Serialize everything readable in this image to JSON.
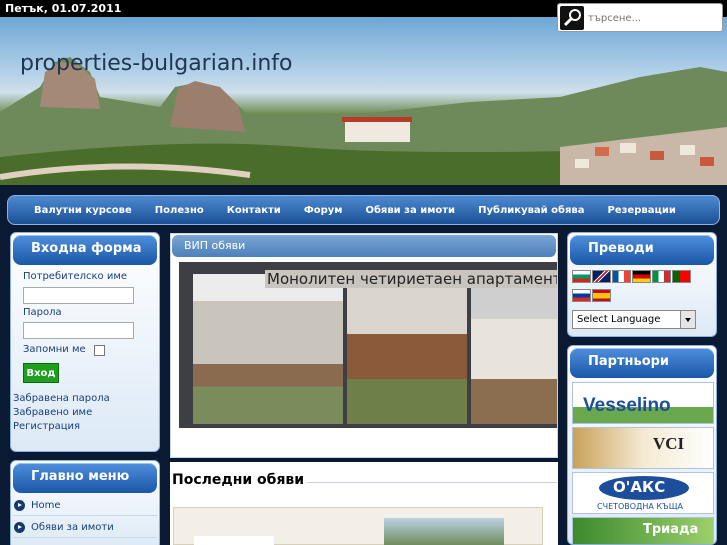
{
  "header": {
    "date": "Петък, 01.07.2011",
    "site_title": "properties-bulgarian.info"
  },
  "search": {
    "placeholder": "търсене..."
  },
  "nav": {
    "items": [
      "Валутни курсове",
      "Полезно",
      "Контакти",
      "Форум",
      "Обяви за имоти",
      "Публикувай обява",
      "Резервации"
    ]
  },
  "login": {
    "title": "Входна форма",
    "username_label": "Потребителско име",
    "password_label": "Парола",
    "remember_label": "Запомни ме",
    "login_button": "Вход",
    "forgot_password": "Забравена парола",
    "forgot_username": "Забравено име",
    "register": "Регистрация"
  },
  "main_menu": {
    "title": "Главно меню",
    "items": [
      "Home",
      "Обяви за имоти"
    ]
  },
  "vip": {
    "title": "ВИП обяви",
    "caption": "Монолитен четириетаен апартамент в"
  },
  "latest": {
    "title": "Последни обяви"
  },
  "translate": {
    "title": "Преводи",
    "select_value": "Select Language",
    "flags": [
      "bulgarian-flag-icon",
      "english-flag-icon",
      "french-flag-icon",
      "german-flag-icon",
      "italian-flag-icon",
      "portuguese-flag-icon",
      "russian-flag-icon",
      "spanish-flag-icon"
    ]
  },
  "partners": {
    "title": "Партньори",
    "logos": [
      "Vesselino",
      "VCI",
      "О'АКС",
      "Триада"
    ],
    "sublabel": "СЧЕТОВОДНА КЪЩА"
  },
  "colors": {
    "nav_blue": "#1b4f95",
    "panel_head": "#1a57a7",
    "login_green": "#1ea01e"
  }
}
